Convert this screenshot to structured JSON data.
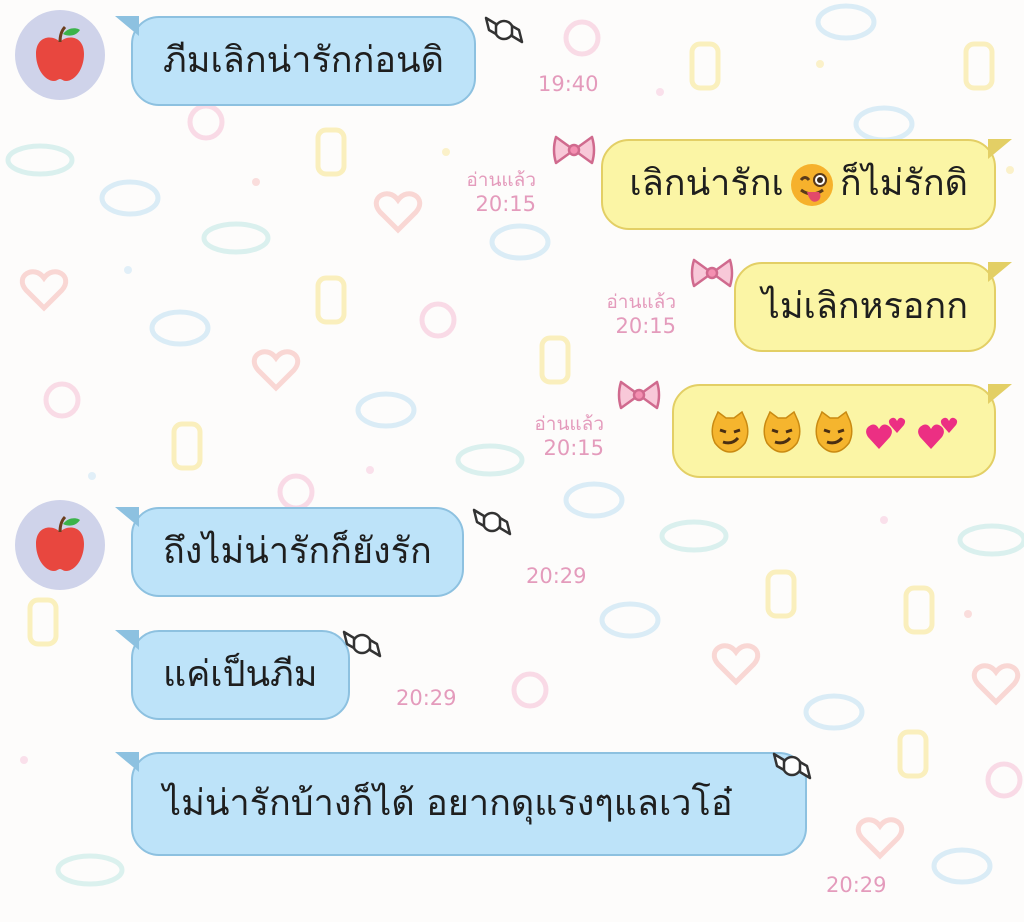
{
  "messages": [
    {
      "side": "in",
      "text": "ภีมเลิกน่ารักก่อนดิ",
      "time": "19:40"
    },
    {
      "side": "out",
      "text_before": "เลิกน่ารักเ",
      "text_after": "ก็ไม่รักดิ",
      "emoji": "winking-face-tongue-icon",
      "read": "อ่านแล้ว",
      "time": "20:15"
    },
    {
      "side": "out",
      "text": "ไม่เลิกหรอกก",
      "read": "อ่านแล้ว",
      "time": "20:15"
    },
    {
      "side": "out",
      "emojis": [
        "smirk-cat-icon",
        "smirk-cat-icon",
        "smirk-cat-icon",
        "two-hearts-icon",
        "two-hearts-icon"
      ],
      "read": "อ่านแล้ว",
      "time": "20:15"
    },
    {
      "side": "in",
      "text": "ถึงไม่น่ารักก็ยังรัก",
      "time": "20:29"
    },
    {
      "side": "in",
      "text": "แค่เป็นภีม",
      "time": "20:29"
    },
    {
      "side": "in",
      "text": "ไม่น่ารักบ้างก็ได้ อยากดุแรงๆแลเวโอ๋",
      "time": "20:29"
    }
  ],
  "avatar_icon": "apple-icon",
  "colors": {
    "incoming_bubble": "#bde3f9",
    "outgoing_bubble": "#fbf5a5",
    "meta_text": "#e49bbc",
    "avatar_bg": "#cfd3ea"
  }
}
